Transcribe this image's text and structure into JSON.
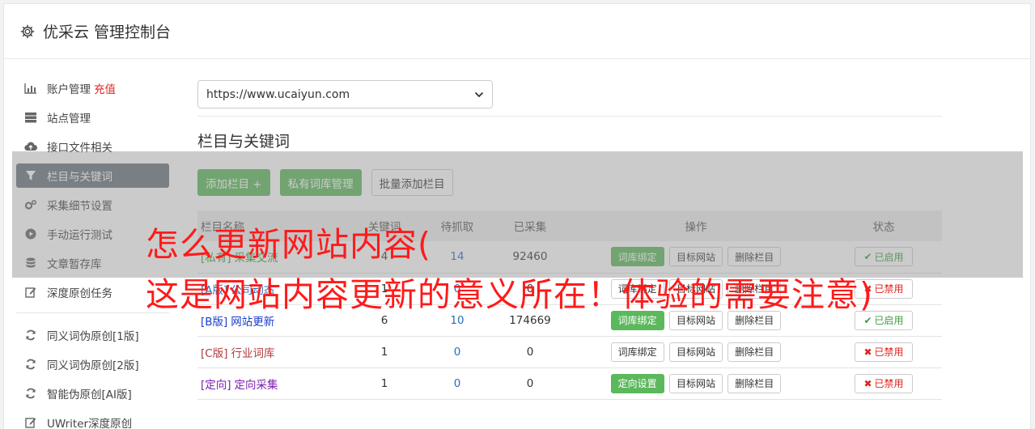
{
  "header": {
    "title": "优采云 管理控制台",
    "icon": "gear-icon"
  },
  "sidebar": {
    "items": [
      {
        "label": "账户管理",
        "extra": "充值",
        "icon": "bar-chart-icon"
      },
      {
        "label": "站点管理",
        "icon": "server-icon"
      },
      {
        "label": "接口文件相关",
        "icon": "cloud-upload-icon"
      },
      {
        "label": "栏目与关键词",
        "icon": "filter-icon",
        "active": true
      },
      {
        "label": "采集细节设置",
        "icon": "gears-icon"
      },
      {
        "label": "手动运行测试",
        "icon": "play-circle-icon"
      },
      {
        "label": "文章暂存库",
        "icon": "database-icon"
      },
      {
        "label": "深度原创任务",
        "icon": "edit-icon"
      }
    ],
    "items2": [
      {
        "label": "同义词伪原创[1版]",
        "icon": "refresh-icon"
      },
      {
        "label": "同义词伪原创[2版]",
        "icon": "refresh-icon"
      },
      {
        "label": "智能伪原创[AI版]",
        "icon": "refresh-icon"
      },
      {
        "label": "UWriter深度原创",
        "icon": "edit-icon"
      }
    ]
  },
  "site_select": {
    "value": "https://www.ucaiyun.com"
  },
  "section_title": "栏目与关键词",
  "toolbar": {
    "add_column": "添加栏目 +",
    "private_lib": "私有词库管理",
    "batch_add": "批量添加栏目"
  },
  "table": {
    "headers": [
      "栏目名称",
      "关键词",
      "待抓取",
      "已采集",
      "操作",
      "状态"
    ],
    "rows": [
      {
        "tag": "[私有]",
        "name": "采集交流",
        "color": "#3c9d3c",
        "keywords": "4",
        "pending": "14",
        "collected": "92460",
        "op1": "词库绑定",
        "op1_green": true,
        "op2": "目标网站",
        "op3": "删除栏目",
        "status": "已启用",
        "enabled": true
      },
      {
        "tag": "[A版]",
        "name": "公司动态",
        "color": "#2a6ebb",
        "keywords": "1",
        "pending": "0",
        "collected": "0",
        "op1": "词库绑定",
        "op1_green": false,
        "op2": "目标网站",
        "op3": "删除栏目",
        "status": "已禁用",
        "enabled": false
      },
      {
        "tag": "[B版]",
        "name": "网站更新",
        "color": "#1a3ccc",
        "keywords": "6",
        "pending": "10",
        "collected": "174669",
        "op1": "词库绑定",
        "op1_green": true,
        "op2": "目标网站",
        "op3": "删除栏目",
        "status": "已启用",
        "enabled": true
      },
      {
        "tag": "[C版]",
        "name": "行业词库",
        "color": "#b03a3a",
        "keywords": "1",
        "pending": "0",
        "collected": "0",
        "op1": "词库绑定",
        "op1_green": false,
        "op2": "目标网站",
        "op3": "删除栏目",
        "status": "已禁用",
        "enabled": false
      },
      {
        "tag": "[定向]",
        "name": "定向采集",
        "color": "#7a1fb0",
        "keywords": "1",
        "pending": "0",
        "collected": "0",
        "op1": "定向设置",
        "op1_green": true,
        "op2": "目标网站",
        "op3": "删除栏目",
        "status": "已禁用",
        "enabled": false
      }
    ]
  },
  "overlay": {
    "line1": "怎么更新网站内容(",
    "line2": "这是网站内容更新的意义所在！体验的需要注意)"
  },
  "colors": {
    "green": "#5cb85c",
    "active_side": "#6c757d",
    "overlay_text": "#ff1a1a",
    "enabled": "#3c9d3c",
    "disabled": "#e0231f"
  }
}
